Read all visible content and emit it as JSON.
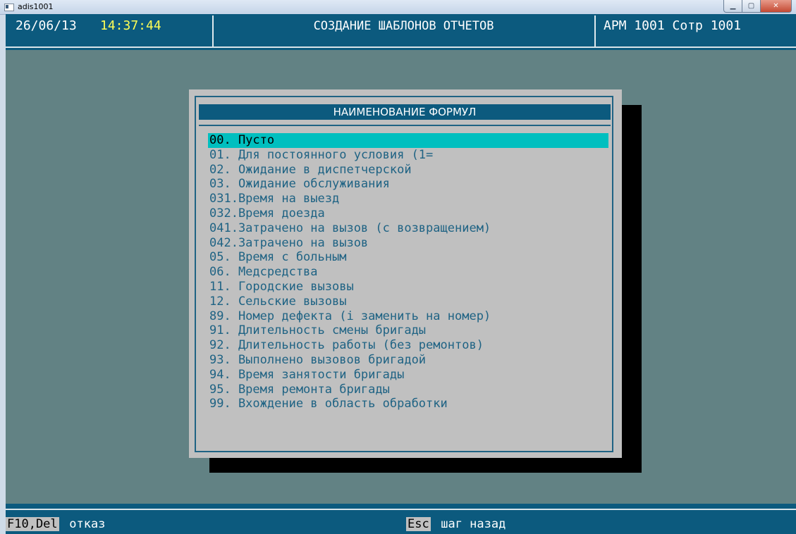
{
  "window": {
    "title": "adis1001",
    "buttons": {
      "minimize": "▁",
      "maximize": "▢",
      "close": "✕"
    }
  },
  "header": {
    "date": "26/06/13",
    "time": "14:37:44",
    "title": "СОЗДАНИЕ ШАБЛОНОВ ОТЧЕТОВ",
    "user": "АРМ 1001 Сотр 1001"
  },
  "dialog": {
    "title": "НАИМЕНОВАНИЕ ФОРМУЛ",
    "items": [
      "00. Пусто",
      "01. Для постоянного условия (1=",
      "02. Ожидание в диспетчерской",
      "03. Ожидание обслуживания",
      "031.Время на выезд",
      "032.Время доезда",
      "041.Затрачено на вызов (с возвращением)",
      "042.Затрачено на вызов",
      "05. Время с больным",
      "06. Медсредства",
      "11. Городские вызовы",
      "12. Сельские вызовы",
      "89. Номер дефекта (i заменить на номер)",
      "91. Длительность смены бригады",
      "92. Длительность работы (без ремонтов)",
      "93. Выполнено вызовов бригадой",
      "94. Время занятости бригады",
      "95. Время ремонта бригады",
      "99. Вхождение в область обработки"
    ],
    "selected_index": 0
  },
  "footer": {
    "key1": "F10,Del",
    "text1": " отказ",
    "key2": "Esc",
    "text2": " шаг назад"
  },
  "colors": {
    "console_bg": "#628284",
    "bar_blue": "#0c5a7e",
    "dialog_bg": "#c0c0c0",
    "item_text": "#1f6384",
    "selected_bg": "#00bfbf",
    "time_yellow": "#ffff55"
  }
}
